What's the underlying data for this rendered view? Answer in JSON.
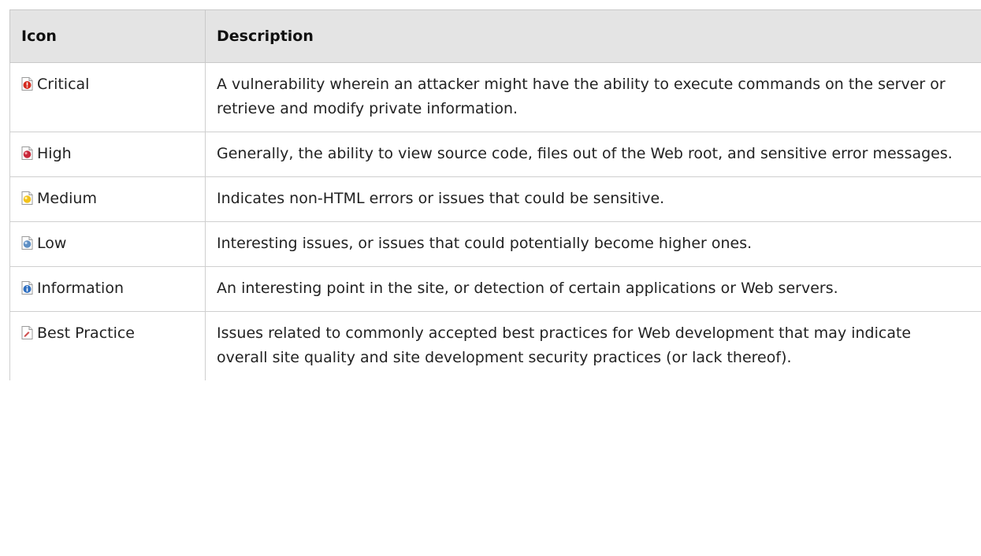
{
  "table": {
    "headers": {
      "icon": "Icon",
      "description": "Description"
    },
    "rows": [
      {
        "icon": "critical-icon",
        "label": "Critical",
        "description": "A vulnerability wherein an attacker might have the ability to execute commands on the server or retrieve and modify private information."
      },
      {
        "icon": "high-icon",
        "label": "High",
        "description": "Generally, the ability to view source code, files out of the Web root, and sensitive error messages."
      },
      {
        "icon": "medium-icon",
        "label": "Medium",
        "description": "Indicates non-HTML errors or issues that could be sensitive."
      },
      {
        "icon": "low-icon",
        "label": "Low",
        "description": "Interesting issues, or issues that could potentially become higher ones."
      },
      {
        "icon": "information-icon",
        "label": "Information",
        "description": "An interesting point in the site, or detection of certain applications or Web servers."
      },
      {
        "icon": "best-practice-icon",
        "label": "Best Practice",
        "description": "Issues related to commonly accepted best practices for Web development that may indicate overall site quality and site development security practices (or lack thereof)."
      }
    ]
  },
  "colors": {
    "critical": "#d42a1e",
    "high": "#c8283a",
    "medium": "#f2c21b",
    "low": "#5e8fc4",
    "information": "#2f6fc0",
    "best_practice": "#d05050",
    "header_bg": "#e4e4e4",
    "border": "#cfcfcf"
  }
}
